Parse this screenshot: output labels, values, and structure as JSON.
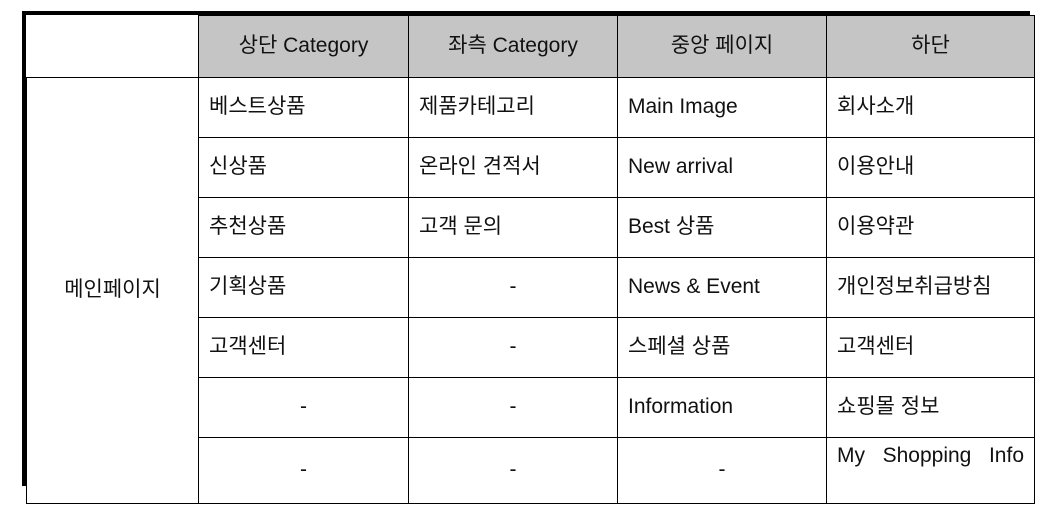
{
  "table": {
    "row_label": "메인페이지",
    "headers": [
      "상단 Category",
      "좌측 Category",
      "중앙 페이지",
      "하단"
    ],
    "rows": [
      [
        "베스트상품",
        "제품카테고리",
        "Main Image",
        "회사소개"
      ],
      [
        "신상품",
        "온라인 견적서",
        "New arrival",
        "이용안내"
      ],
      [
        "추천상품",
        "고객 문의",
        "Best 상품",
        "이용약관"
      ],
      [
        "기획상품",
        "-",
        "News & Event",
        "개인정보취급방침"
      ],
      [
        "고객센터",
        "-",
        "스페셜 상품",
        "고객센터"
      ],
      [
        "-",
        "-",
        "Information",
        "쇼핑몰 정보"
      ],
      [
        "-",
        "-",
        "-",
        "My Shopping Info"
      ]
    ]
  },
  "colors": {
    "header_background": "#c5c5c5",
    "border": "#000000",
    "text": "#111111",
    "page_background": "#ffffff"
  }
}
